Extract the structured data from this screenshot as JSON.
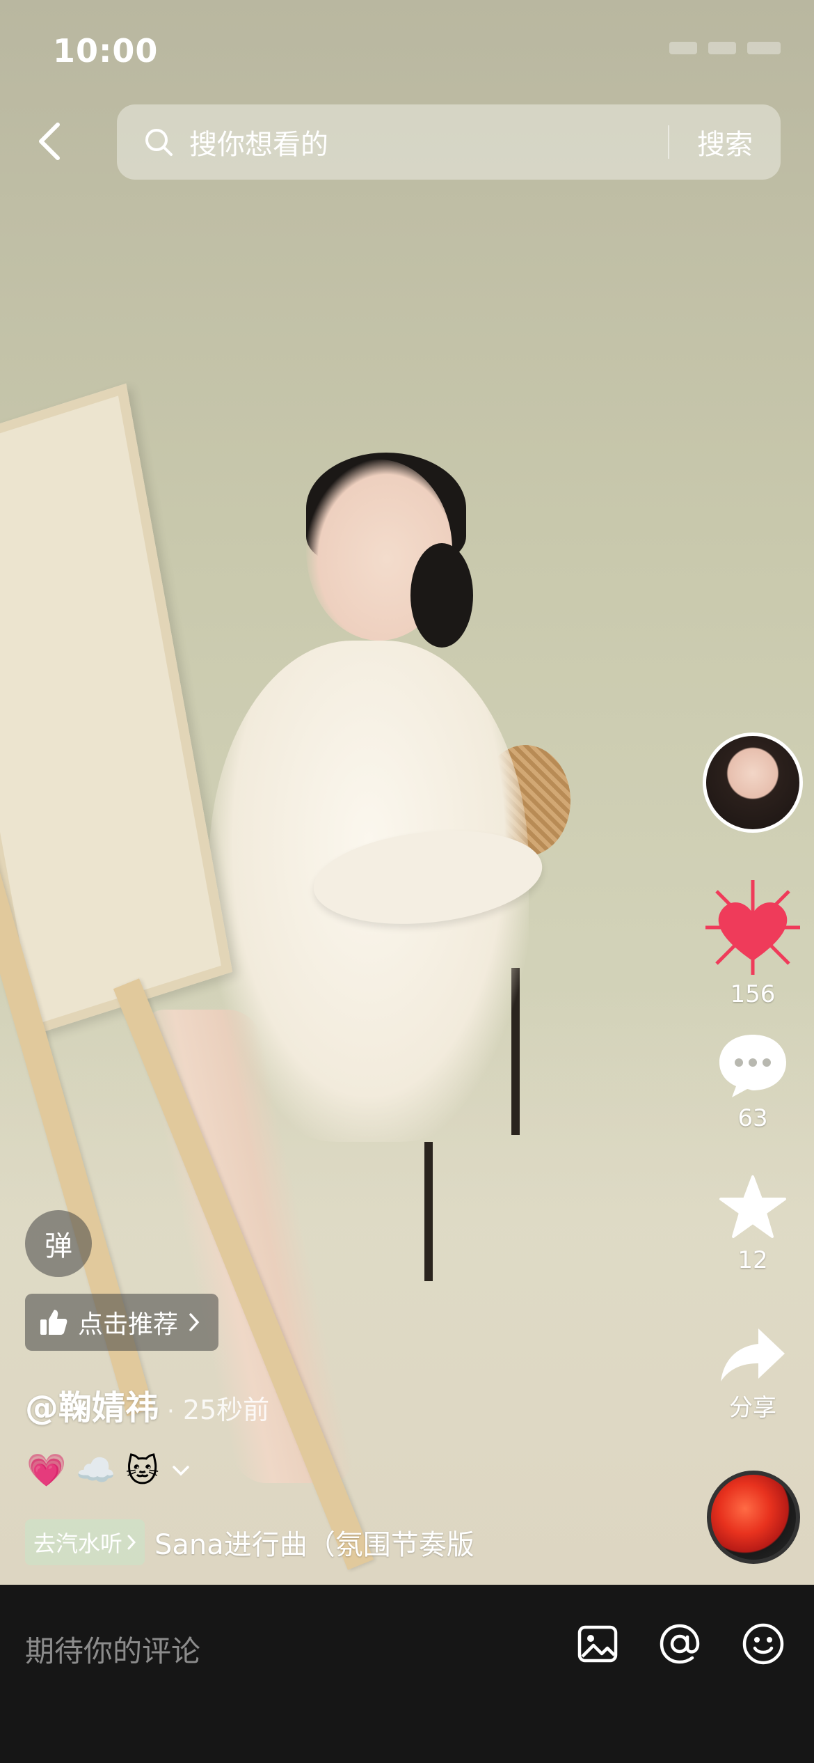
{
  "status_bar": {
    "time": "10:00"
  },
  "search": {
    "placeholder": "搜你想看的",
    "button_label": "搜索"
  },
  "rail": {
    "likes": "156",
    "comments": "63",
    "favorites": "12",
    "share_label": "分享"
  },
  "overlay": {
    "danmu_label": "弹",
    "recommend_label": "点击推荐",
    "author": "@鞠婧祎",
    "separator": "·",
    "post_time": "25秒前",
    "emojis": [
      "💗",
      "☁️",
      "🐱"
    ],
    "qishui_tag": "去汽水听",
    "music_title": "Sana进行曲（氛围节奏版"
  },
  "comment_bar": {
    "placeholder": "期待你的评论"
  },
  "colors": {
    "like_red": "#ef3b5a",
    "comment_bar_bg": "#161616"
  },
  "icons": [
    "chevron-left-icon",
    "search-icon",
    "heart-icon",
    "comment-bubble-icon",
    "star-icon",
    "share-arrow-icon",
    "thumbs-up-icon",
    "image-icon",
    "at-icon",
    "emoji-face-icon"
  ]
}
